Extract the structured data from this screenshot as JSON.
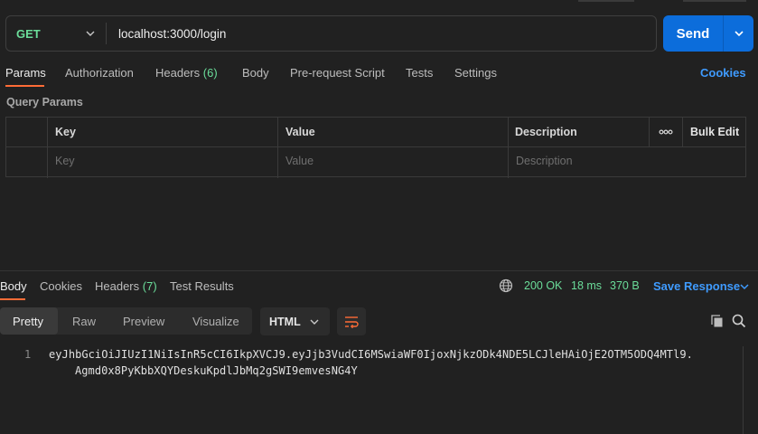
{
  "request": {
    "method": "GET",
    "url": "localhost:3000/login",
    "send_label": "Send"
  },
  "request_tabs": {
    "params": "Params",
    "authorization": "Authorization",
    "headers": "Headers",
    "headers_count": "(6)",
    "body": "Body",
    "pre_request": "Pre-request Script",
    "tests": "Tests",
    "settings": "Settings",
    "cookies": "Cookies"
  },
  "query_params": {
    "title": "Query Params",
    "columns": [
      "Key",
      "Value",
      "Description"
    ],
    "placeholders": [
      "Key",
      "Value",
      "Description"
    ],
    "bulk_edit": "Bulk Edit"
  },
  "response_tabs": {
    "body": "Body",
    "cookies": "Cookies",
    "headers": "Headers",
    "headers_count": "(7)",
    "test_results": "Test Results"
  },
  "response_meta": {
    "status": "200 OK",
    "time": "18 ms",
    "size": "370 B",
    "save_response": "Save Response"
  },
  "view_modes": [
    "Pretty",
    "Raw",
    "Preview",
    "Visualize"
  ],
  "format": "HTML",
  "response_body": {
    "line_number": "1",
    "line_1": "eyJhbGciOiJIUzI1NiIsInR5cCI6IkpXVCJ9.eyJjb3VudCI6MSwiaWF0IjoxNjkzODk4NDE5LCJleHAiOjE2OTM5ODQ4MTl9.",
    "line_2": "Agmd0x8PyKbbXQYDeskuKpdlJbMq2gSWI9emvesNG4Y"
  },
  "colors": {
    "background": "#212121",
    "accent_blue": "#0c6ddb",
    "link_blue": "#3f9bff",
    "method_green": "#6bdd9a",
    "tab_orange": "#ff6c37"
  },
  "icons": [
    "chevron-down-icon",
    "more-horizontal-icon",
    "globe-icon",
    "wrap-lines-icon",
    "copy-icon",
    "search-icon"
  ]
}
